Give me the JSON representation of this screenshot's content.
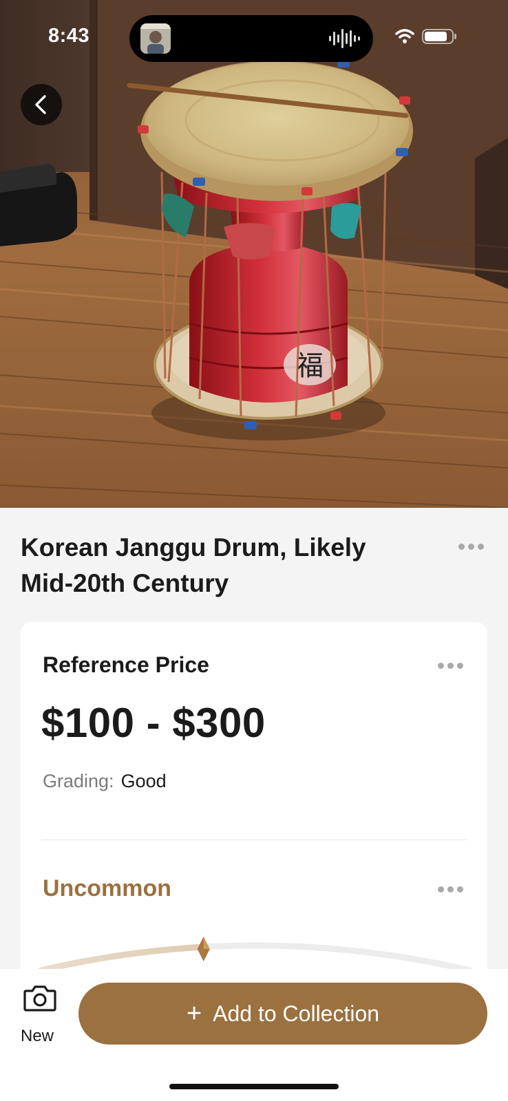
{
  "status_bar": {
    "time": "8:43",
    "icons": [
      "wifi-icon",
      "battery-icon"
    ]
  },
  "hero": {
    "photo": "korean-janggu-drum-photo",
    "back_icon": "chevron-left-icon"
  },
  "item": {
    "title": "Korean Janggu Drum, Likely Mid-20th Century",
    "more_icon": "ellipsis-icon"
  },
  "valuation": {
    "section_label": "Reference Price",
    "price_range": "$100 - $300",
    "grading_label": "Grading:",
    "grading_value": "Good"
  },
  "rarity": {
    "label": "Uncommon",
    "level": 0.38
  },
  "bottom_bar": {
    "new_label": "New",
    "new_icon": "camera-icon",
    "add_plus": "+",
    "add_label": "Add to Collection"
  },
  "colors": {
    "accent": "#9b7140",
    "background": "#f4f4f4",
    "card": "#ffffff",
    "text": "#1b1b1b",
    "muted": "#7a7a7a"
  }
}
